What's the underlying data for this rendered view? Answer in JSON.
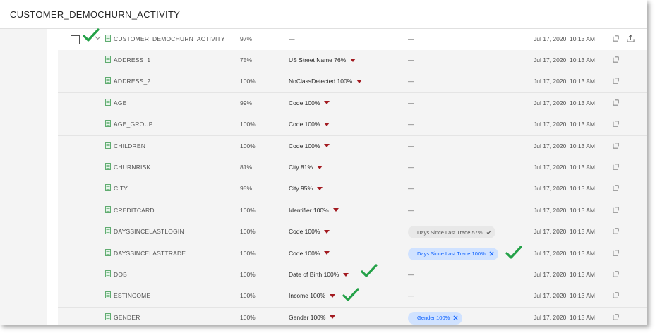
{
  "page_title": "CUSTOMER_DEMOCHURN_ACTIVITY",
  "parent_row": {
    "name": "CUSTOMER_DEMOCHURN_ACTIVITY",
    "quality": "97%",
    "classification": "—",
    "terms": "—",
    "updated": "Jul 17, 2020, 10:13 AM"
  },
  "rows": [
    {
      "name": "ADDRESS_1",
      "quality": "75%",
      "classification": "US Street Name 76%",
      "terms": "—",
      "updated": "Jul 17, 2020, 10:13 AM"
    },
    {
      "name": "ADDRESS_2",
      "quality": "100%",
      "classification": "NoClassDetected 100%",
      "terms": "—",
      "updated": "Jul 17, 2020, 10:13 AM"
    },
    {
      "name": "AGE",
      "quality": "99%",
      "classification": "Code 100%",
      "terms": "—",
      "updated": "Jul 17, 2020, 10:13 AM"
    },
    {
      "name": "AGE_GROUP",
      "quality": "100%",
      "classification": "Code 100%",
      "terms": "—",
      "updated": "Jul 17, 2020, 10:13 AM"
    },
    {
      "name": "CHILDREN",
      "quality": "100%",
      "classification": "Code 100%",
      "terms": "—",
      "updated": "Jul 17, 2020, 10:13 AM"
    },
    {
      "name": "CHURNRISK",
      "quality": "81%",
      "classification": "City 81%",
      "terms": "—",
      "updated": "Jul 17, 2020, 10:13 AM"
    },
    {
      "name": "CITY",
      "quality": "95%",
      "classification": "City 95%",
      "terms": "—",
      "updated": "Jul 17, 2020, 10:13 AM"
    },
    {
      "name": "CREDITCARD",
      "quality": "100%",
      "classification": "Identifier 100%",
      "terms": "—",
      "updated": "Jul 17, 2020, 10:13 AM"
    },
    {
      "name": "DAYSSINCELASTLOGIN",
      "quality": "100%",
      "classification": "Code 100%",
      "term_tag": "Days Since Last Trade  57%",
      "tag_style": "gray",
      "updated": "Jul 17, 2020, 10:13 AM"
    },
    {
      "name": "DAYSSINCELASTTRADE",
      "quality": "100%",
      "classification": "Code 100%",
      "term_tag": "Days Since Last Trade  100%",
      "tag_style": "blue",
      "updated": "Jul 17, 2020, 10:13 AM"
    },
    {
      "name": "DOB",
      "quality": "100%",
      "classification": "Date of Birth 100%",
      "terms": "—",
      "updated": "Jul 17, 2020, 10:13 AM"
    },
    {
      "name": "ESTINCOME",
      "quality": "100%",
      "classification": "Income 100%",
      "terms": "—",
      "updated": "Jul 17, 2020, 10:13 AM"
    },
    {
      "name": "GENDER",
      "quality": "100%",
      "classification": "Gender 100%",
      "term_tag": "Gender 100%",
      "tag_style": "blue",
      "updated": "Jul 17, 2020, 10:13 AM"
    }
  ],
  "colors": {
    "caret": "#a2191f",
    "checkmark": "#24a148",
    "tag_blue_bg": "#d0e2ff",
    "tag_blue_text": "#0f62fe",
    "tag_gray_bg": "#e8e8e8"
  }
}
